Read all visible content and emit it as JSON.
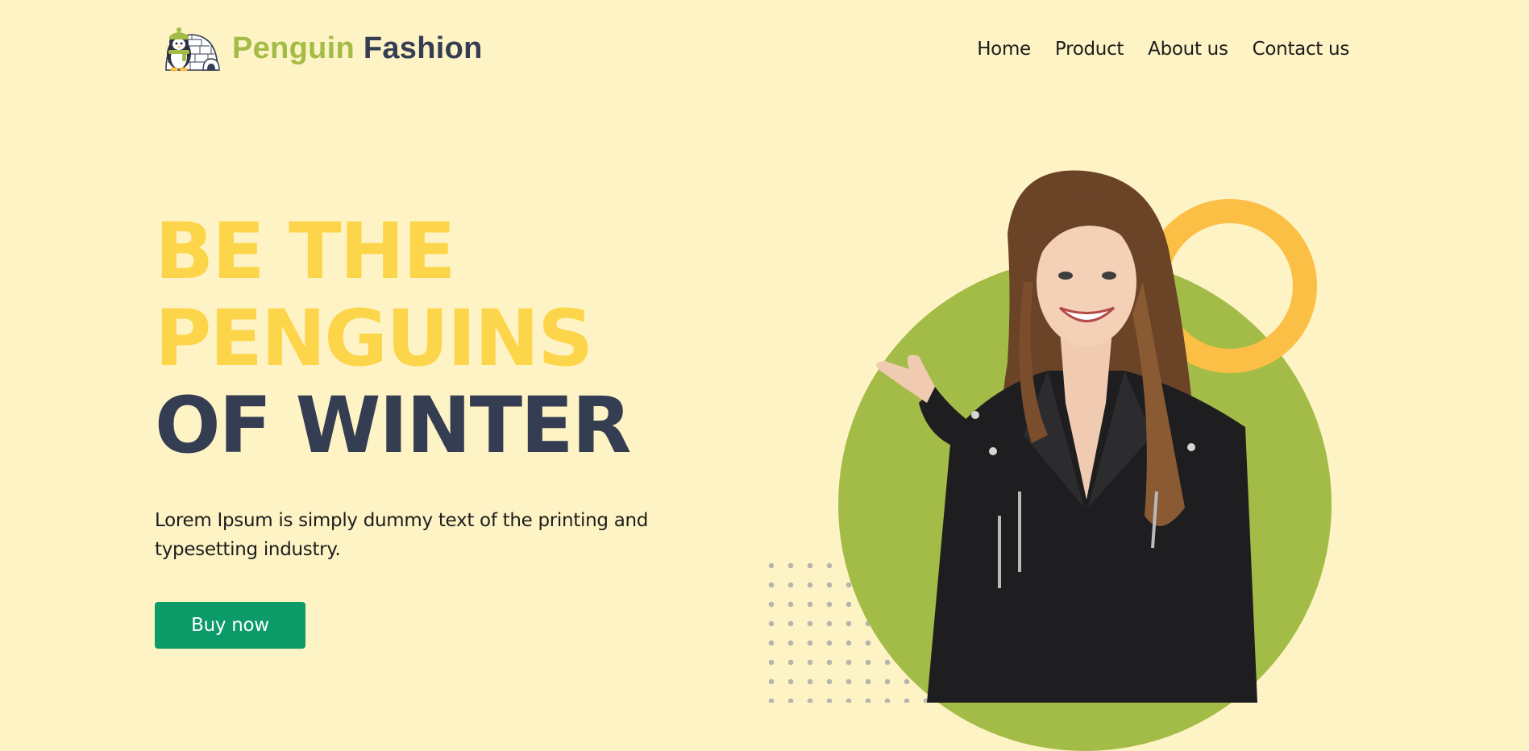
{
  "brand": {
    "name_part1": "Penguin",
    "name_part2": "Fashion",
    "logo_icon": "penguin-igloo-icon"
  },
  "nav": {
    "items": [
      "Home",
      "Product",
      "About us",
      "Contact us"
    ]
  },
  "hero": {
    "title_line1": "BE THE",
    "title_line2": "PENGUINS",
    "title_line3": "OF WINTER",
    "description": "Lorem Ipsum is simply dummy text of the printing and typesetting industry.",
    "cta_label": "Buy now"
  },
  "colors": {
    "background": "#FEF3C4",
    "brand_green": "#A3BC47",
    "navy": "#343D52",
    "title_yellow": "#FCD54A",
    "cta_green": "#0B9A68",
    "ring_orange": "#FBBF45"
  }
}
